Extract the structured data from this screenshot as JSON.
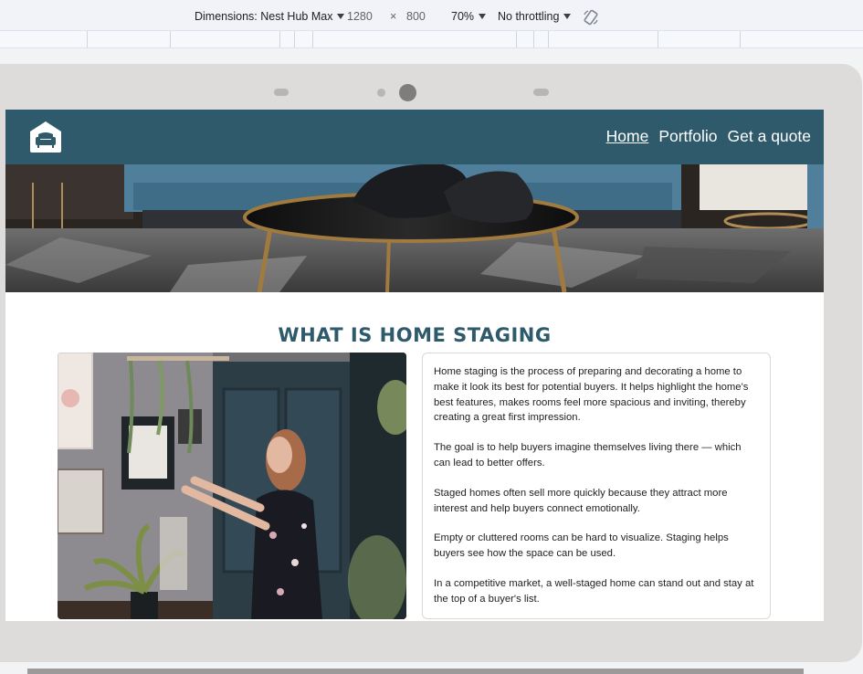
{
  "devtools": {
    "dimensions_label": "Dimensions: Nest Hub Max",
    "width": "1280",
    "times": "×",
    "height": "800",
    "zoom": "70%",
    "throttling": "No throttling",
    "rotate_icon": "rotate-icon"
  },
  "site": {
    "logo_icon": "sofa-home-icon",
    "nav": [
      {
        "label": "Home",
        "active": true
      },
      {
        "label": "Portfolio",
        "active": false
      },
      {
        "label": "Get a quote",
        "active": false
      }
    ],
    "section_title": "WHAT IS HOME STAGING",
    "paragraphs": [
      "Home staging is the process of preparing and decorating a home to make it look its best for potential buyers. It helps highlight the home's best features, makes rooms feel more spacious and inviting, thereby creating a great first impression.",
      "The goal is to help buyers imagine themselves living there — which can lead to better offers.",
      "Staged homes often sell more quickly because they attract more interest and help buyers connect emotionally.",
      "Empty or cluttered rooms can be hard to visualize. Staging helps buyers see how the space can be used.",
      "In a competitive market, a well-staged home can stand out and stay at the top of a buyer's list."
    ],
    "colors": {
      "brand": "#2e5a6b",
      "page_bg": "#ffffff"
    }
  }
}
